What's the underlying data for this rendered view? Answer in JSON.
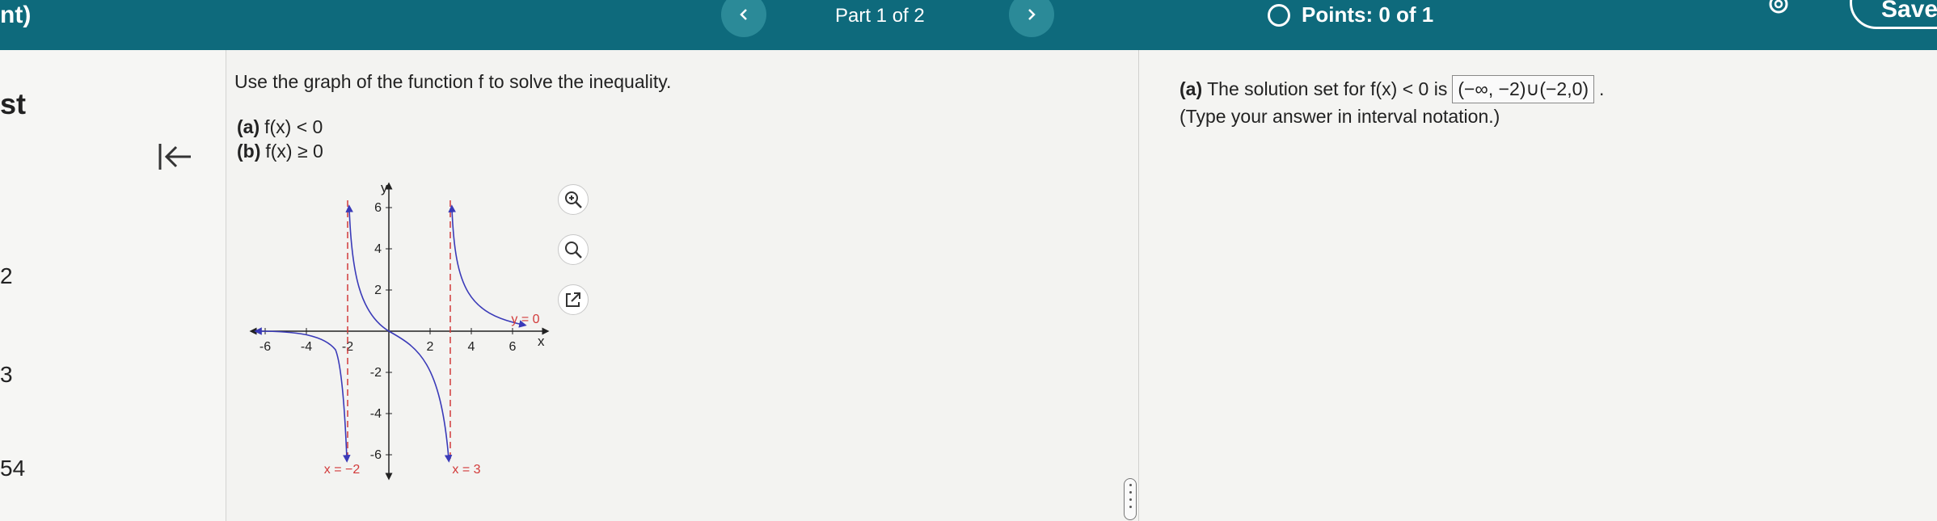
{
  "header": {
    "title_fragment": "nt)",
    "part_label": "Part 1 of 2",
    "points_label": "Points: 0 of 1",
    "save_label": "Save"
  },
  "sidebar": {
    "heading": "st",
    "items": [
      "2",
      "3",
      "54"
    ]
  },
  "question": {
    "prompt": "Use the graph of the function f to solve the inequality.",
    "parts": [
      {
        "tag": "(a)",
        "text": "f(x) < 0"
      },
      {
        "tag": "(b)",
        "text": "f(x) ≥ 0"
      }
    ]
  },
  "graph": {
    "x_axis_label": "x",
    "y_axis_label": "y",
    "x_ticks": [
      "-6",
      "-4",
      "-2",
      "2",
      "4",
      "6"
    ],
    "y_ticks": [
      "6",
      "4",
      "2",
      "-2",
      "-4",
      "-6"
    ],
    "asymptote_labels": [
      "x = −2",
      "x = 3",
      "y = 0"
    ],
    "colors": {
      "curve": "#3a3ab8",
      "asymptote": "#d23a3a"
    }
  },
  "tools": [
    "zoom-in-icon",
    "zoom-out-icon",
    "external-link-icon"
  ],
  "answer": {
    "part_tag": "(a)",
    "prefix": "The solution set for f(x) < 0 is",
    "value": "(−∞, −2)∪(−2,0)",
    "suffix": ".",
    "hint": "(Type your answer in interval notation.)"
  }
}
